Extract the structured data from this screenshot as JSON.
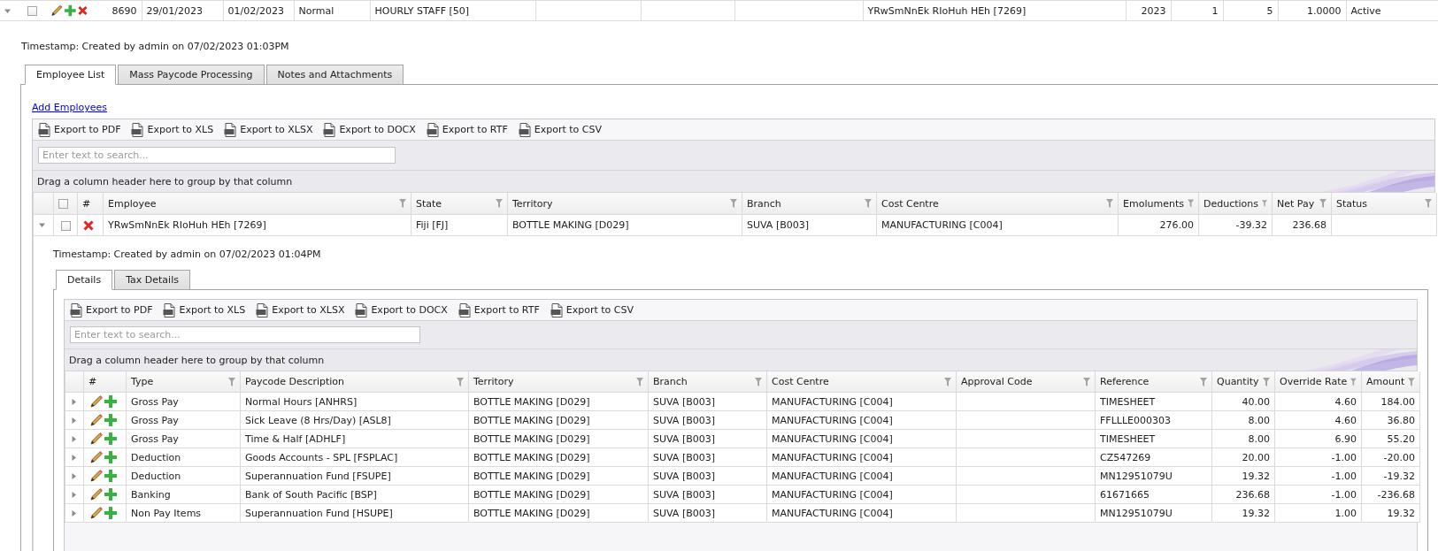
{
  "top_row": {
    "expanded": true,
    "checked": false,
    "values": {
      "column_4": "8690",
      "column_5": "29/01/2023",
      "column_6": "01/02/2023",
      "column_7": "Normal",
      "column_8": "HOURLY STAFF [50]",
      "column_12": "YRwSmNnEk RIoHuh HEh [7269]",
      "column_13": "2023",
      "column_14": "1",
      "column_15": "5",
      "column_16": "1.0000",
      "column_17": "Active"
    }
  },
  "timestamp": "Timestamp: Created by admin on 07/02/2023 01:03PM",
  "tabs": [
    {
      "label": "Employee List",
      "selected": true
    },
    {
      "label": "Mass Paycode Processing",
      "selected": false
    },
    {
      "label": "Notes and Attachments",
      "selected": false
    }
  ],
  "add_employees_link": "Add Employees",
  "employee_grid": {
    "export_buttons": [
      "Export to PDF",
      "Export to XLS",
      "Export to XLSX",
      "Export to DOCX",
      "Export to RTF",
      "Export to CSV"
    ],
    "search": {
      "placeholder": "Enter text to search..."
    },
    "group_panel_hint": "Drag a column header here to group by that column",
    "header_checkbox": {
      "checked": false
    },
    "columns": [
      {
        "label": "#",
        "filterable": false
      },
      {
        "label": "Employee",
        "filterable": true
      },
      {
        "label": "State",
        "filterable": true
      },
      {
        "label": "Territory",
        "filterable": true
      },
      {
        "label": "Branch",
        "filterable": true
      },
      {
        "label": "Cost Centre",
        "filterable": true
      },
      {
        "label": "Emoluments",
        "filterable": true
      },
      {
        "label": "Deductions",
        "filterable": true
      },
      {
        "label": "Net Pay",
        "filterable": true
      },
      {
        "label": "Status",
        "filterable": true
      }
    ],
    "rows": [
      {
        "expanded": true,
        "checked": false,
        "employee": "YRwSmNnEk RIoHuh HEh [7269]",
        "state": "Fiji [FJ]",
        "territory": "BOTTLE MAKING [D029]",
        "branch": "SUVA [B003]",
        "cost_centre": "MANUFACTURING [C004]",
        "emoluments": "276.00",
        "deductions": "-39.32",
        "net_pay": "236.68",
        "detail": {
          "timestamp": "Timestamp: Created by admin on 07/02/2023 01:04PM",
          "tabs": [
            {
              "label": "Details",
              "selected": true
            },
            {
              "label": "Tax Details",
              "selected": false
            }
          ],
          "grid": {
            "export_buttons": [
              "Export to PDF",
              "Export to XLS",
              "Export to XLSX",
              "Export to DOCX",
              "Export to RTF",
              "Export to CSV"
            ],
            "search": {
              "placeholder": "Enter text to search..."
            },
            "group_panel_hint": "Drag a column header here to group by that column",
            "columns": [
              {
                "label": "#",
                "filterable": false
              },
              {
                "label": "Type",
                "filterable": true
              },
              {
                "label": "Paycode Description",
                "filterable": true
              },
              {
                "label": "Territory",
                "filterable": true
              },
              {
                "label": "Branch",
                "filterable": true
              },
              {
                "label": "Cost Centre",
                "filterable": true
              },
              {
                "label": "Approval Code",
                "filterable": true
              },
              {
                "label": "Reference",
                "filterable": true
              },
              {
                "label": "Quantity",
                "filterable": true
              },
              {
                "label": "Override Rate",
                "filterable": true
              },
              {
                "label": "Amount",
                "filterable": true
              }
            ],
            "rows": [
              {
                "expanded": false,
                "type": "Gross Pay",
                "paycode_description": "Normal Hours [ANHRS]",
                "territory": "BOTTLE MAKING [D029]",
                "branch": "SUVA [B003]",
                "cost_centre": "MANUFACTURING [C004]",
                "reference": "TIMESHEET",
                "quantity": "40.00",
                "override_rate": "4.60",
                "amount": "184.00"
              },
              {
                "expanded": false,
                "type": "Gross Pay",
                "paycode_description": "Sick Leave (8 Hrs/Day) [ASL8]",
                "territory": "BOTTLE MAKING [D029]",
                "branch": "SUVA [B003]",
                "cost_centre": "MANUFACTURING [C004]",
                "reference": "FFLLLE000303",
                "quantity": "8.00",
                "override_rate": "4.60",
                "amount": "36.80"
              },
              {
                "expanded": false,
                "type": "Gross Pay",
                "paycode_description": "Time & Half [ADHLF]",
                "territory": "BOTTLE MAKING [D029]",
                "branch": "SUVA [B003]",
                "cost_centre": "MANUFACTURING [C004]",
                "reference": "TIMESHEET",
                "quantity": "8.00",
                "override_rate": "6.90",
                "amount": "55.20"
              },
              {
                "expanded": false,
                "type": "Deduction",
                "paycode_description": "Goods Accounts - SPL [FSPLAC]",
                "territory": "BOTTLE MAKING [D029]",
                "branch": "SUVA [B003]",
                "cost_centre": "MANUFACTURING [C004]",
                "reference": "CZ547269",
                "quantity": "20.00",
                "override_rate": "-1.00",
                "amount": "-20.00"
              },
              {
                "expanded": false,
                "type": "Deduction",
                "paycode_description": "Superannuation Fund [FSUPE]",
                "territory": "BOTTLE MAKING [D029]",
                "branch": "SUVA [B003]",
                "cost_centre": "MANUFACTURING [C004]",
                "reference": "MN12951079U",
                "quantity": "19.32",
                "override_rate": "-1.00",
                "amount": "-19.32"
              },
              {
                "expanded": false,
                "type": "Banking",
                "paycode_description": "Bank of South Pacific [BSP]",
                "territory": "BOTTLE MAKING [D029]",
                "branch": "SUVA [B003]",
                "cost_centre": "MANUFACTURING [C004]",
                "reference": "61671665",
                "quantity": "236.68",
                "override_rate": "-1.00",
                "amount": "-236.68"
              },
              {
                "expanded": false,
                "type": "Non Pay Items",
                "paycode_description": "Superannuation Fund [HSUPE]",
                "territory": "BOTTLE MAKING [D029]",
                "branch": "SUVA [B003]",
                "cost_centre": "MANUFACTURING [C004]",
                "reference": "MN12951079U",
                "quantity": "19.32",
                "override_rate": "1.00",
                "amount": "19.32"
              }
            ]
          }
        }
      }
    ]
  }
}
